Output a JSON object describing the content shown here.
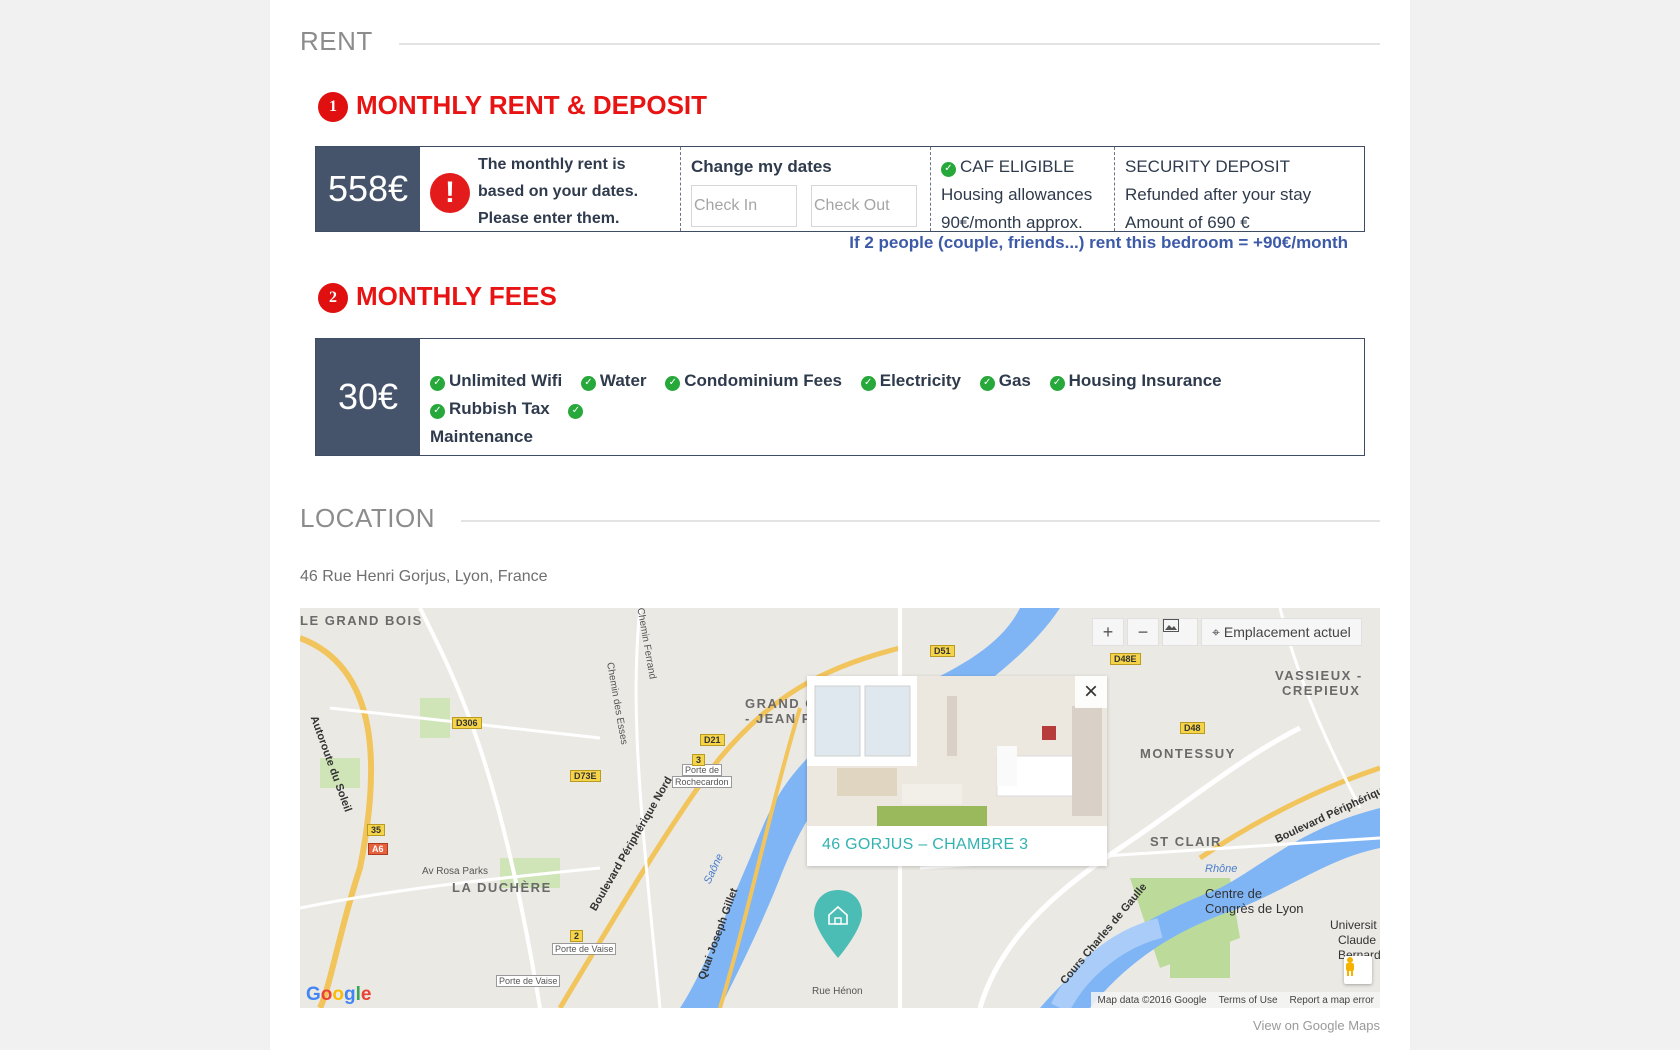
{
  "rent_section": {
    "title": "RENT",
    "step1": {
      "number": "1",
      "title": "MONTHLY RENT & DEPOSIT",
      "price": "558€",
      "alert_text_lines": [
        "The monthly rent is",
        "based on your dates.",
        "Please enter them."
      ],
      "dates_title": "Change my dates",
      "check_in_placeholder": "Check In",
      "check_out_placeholder": "Check Out",
      "caf_title": "CAF ELIGIBLE",
      "caf_lines": [
        "Housing allowances",
        "90€/month approx."
      ],
      "deposit_lines": [
        "SECURITY DEPOSIT",
        "Refunded after your stay",
        "Amount of 690 €"
      ],
      "note": "If 2 people (couple, friends...) rent this bedroom = +90€/month"
    },
    "step2": {
      "number": "2",
      "title": "MONTHLY FEES",
      "price": "30€",
      "fees": [
        "Unlimited Wifi",
        "Water",
        "Condominium Fees",
        "Electricity",
        "Gas",
        "Housing Insurance",
        "Rubbish Tax",
        "Maintenance"
      ]
    }
  },
  "location_section": {
    "title": "LOCATION",
    "address": "46 Rue Henri Gorjus, Lyon, France",
    "map": {
      "zoom_in": "+",
      "zoom_out": "−",
      "current_location": "Emplacement actuel",
      "popup_title": "46 GORJUS – CHAMBRE 3",
      "footer": [
        "Map data ©2016 Google",
        "Terms of Use",
        "Report a map error"
      ],
      "google_logo": "Google",
      "labels": {
        "grand_bois": "LE GRAND BOIS",
        "grand_camp": "GRAND C",
        "jean": "- JEAN P",
        "vassieux": "VASSIEUX -",
        "crepieux": "CREPIEUX",
        "montessuy": "MONTESSUY",
        "st_clair": "ST CLAIR",
        "duchere": "LA DUCHÈRE",
        "centre_congres_1": "Centre de",
        "centre_congres_2": "Congrès de Lyon",
        "universite_1": "Universit",
        "universite_2": "Claude",
        "universite_3": "Bernard",
        "rue_henon": "Rue Hénon",
        "av_rosa_parks": "Av Rosa Parks",
        "rhone": "Rhône",
        "saone": "Saône",
        "bd_peripherique_nord": "Boulevard Périphérique Nord",
        "bd_peripherique": "Boulevard Périphérique",
        "quai_joseph_gillet": "Quai Joseph Gillet",
        "cours_charles_de_gaulle": "Cours Charles de Gaulle",
        "chemin_ferrand": "Chemin Ferrand",
        "chemin_des_esses": "Chemin des Esses",
        "route_du_soleil": "Autoroute du Soleil",
        "porte_rochecardon_1": "Porte de",
        "porte_rochecardon_2": "Rochecardon",
        "porte_vaise": "Porte de Vaise"
      },
      "road_tags": [
        "D306",
        "D21",
        "D73E",
        "D51",
        "D48E",
        "D48",
        "A6",
        "35",
        "3",
        "2"
      ]
    },
    "view_link": "View on Google Maps"
  },
  "colors": {
    "accent_red": "#e81414",
    "price_bg": "#46546b",
    "check_green": "#27a83a",
    "note_blue": "#3c5aa8",
    "teal": "#32b3b1"
  }
}
